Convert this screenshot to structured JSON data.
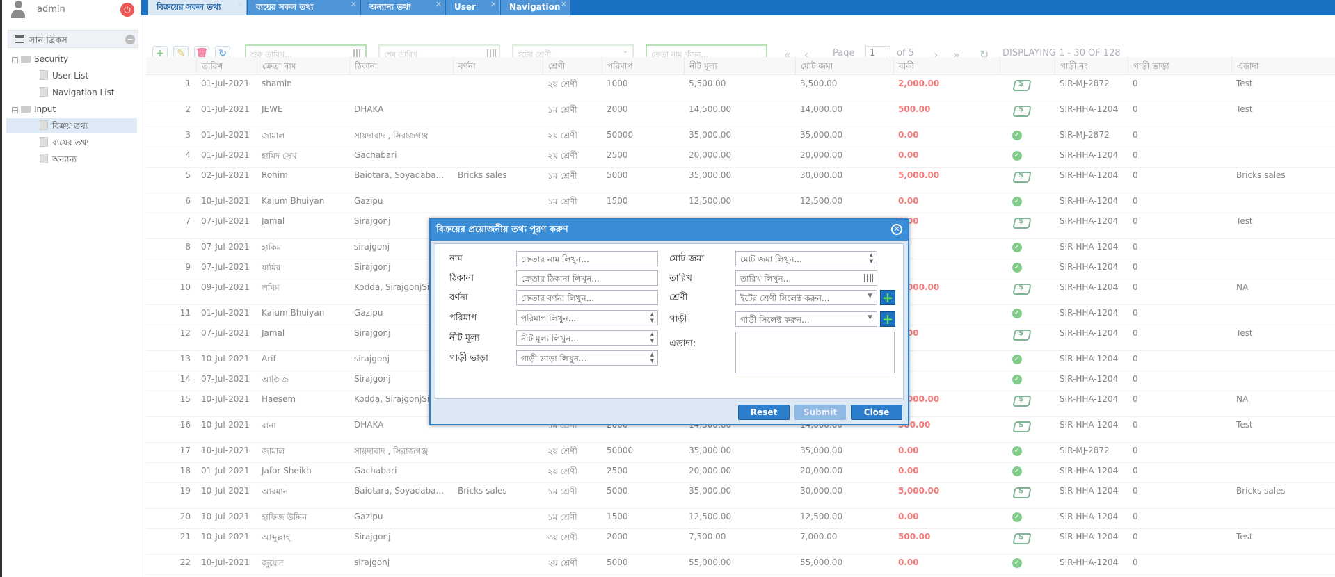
{
  "user": {
    "name": "admin"
  },
  "nav": {
    "group_title": "সান ব্রিকস",
    "tree": [
      {
        "label": "Security",
        "level": 1,
        "type": "folder"
      },
      {
        "label": "User List",
        "level": 2,
        "type": "doc"
      },
      {
        "label": "Navigation List",
        "level": 2,
        "type": "doc"
      },
      {
        "label": "Input",
        "level": 1,
        "type": "folder"
      },
      {
        "label": "বিক্রয় তথ্য",
        "level": 2,
        "type": "doc",
        "selected": true
      },
      {
        "label": "ব্যয়ের তথ্য",
        "level": 2,
        "type": "doc"
      },
      {
        "label": "অন্যান্য",
        "level": 2,
        "type": "doc"
      }
    ]
  },
  "tabs": [
    {
      "label": "বিক্রয়ের সকল তথ্য",
      "active": true
    },
    {
      "label": "ব্যয়ের সকল তথ্য",
      "active": false
    },
    {
      "label": "অন্যান্য তথ্য",
      "active": false
    },
    {
      "label": "User",
      "active": false
    },
    {
      "label": "Navigation",
      "active": false
    }
  ],
  "filters": {
    "start_date": "শুরু তারিখ...",
    "end_date": "শেষ তারিখ",
    "brick_class": "ইটের শ্রেণী",
    "buyer_search": "ক্রেতা নাম খুঁজুন..."
  },
  "pager": {
    "page_label": "Page",
    "page": "1",
    "of": "of 5",
    "display": "DISPLAYING 1 - 30 OF 128"
  },
  "columns": [
    "তারিখ",
    "ক্রেতা নাম",
    "ঠিকানা",
    "বর্ণনা",
    "শ্রেণী",
    "পরিমাপ",
    "নীট মূল্য",
    "মোট জমা",
    "বাকী",
    "",
    "গাড়ী নং",
    "গাড়ী ভাড়া",
    "এডাদা"
  ],
  "rows": [
    {
      "n": "1",
      "date": "01-Jul-2021",
      "name": "shamin",
      "addr": "",
      "desc": "",
      "cls": "২য় শ্রেণী",
      "qty": "1000",
      "net": "5,500.00",
      "paid": "3,500.00",
      "due": "2,000.00",
      "status": "pay",
      "car": "SIR-MJ-2872",
      "fare": "0",
      "note": "Test"
    },
    {
      "n": "2",
      "date": "01-Jul-2021",
      "name": "JEWE",
      "addr": "DHAKA",
      "desc": "",
      "cls": "১ম শ্রেণী",
      "qty": "2000",
      "net": "14,500.00",
      "paid": "14,000.00",
      "due": "500.00",
      "status": "pay",
      "car": "SIR-HHA-1204",
      "fare": "0",
      "note": "Test"
    },
    {
      "n": "3",
      "date": "01-Jul-2021",
      "name": "জামাল",
      "addr": "সায়দাবাদ , সিরাজগঞ্জ",
      "desc": "",
      "cls": "২য় শ্রেণী",
      "qty": "50000",
      "net": "35,000.00",
      "paid": "35,000.00",
      "due": "0.00",
      "status": "ok",
      "car": "SIR-MJ-2872",
      "fare": "0",
      "note": ""
    },
    {
      "n": "4",
      "date": "01-Jul-2021",
      "name": "হামিদ সেখ",
      "addr": "Gachabari",
      "desc": "",
      "cls": "২য় শ্রেণী",
      "qty": "2500",
      "net": "20,000.00",
      "paid": "20,000.00",
      "due": "0.00",
      "status": "ok",
      "car": "SIR-HHA-1204",
      "fare": "0",
      "note": ""
    },
    {
      "n": "5",
      "date": "02-Jul-2021",
      "name": "Rohim",
      "addr": "Baiotara, Soyadaba...",
      "desc": "Bricks sales",
      "cls": "১ম শ্রেণী",
      "qty": "5000",
      "net": "35,000.00",
      "paid": "30,000.00",
      "due": "5,000.00",
      "status": "pay",
      "car": "SIR-HHA-1204",
      "fare": "0",
      "note": "Bricks sales"
    },
    {
      "n": "6",
      "date": "10-Jul-2021",
      "name": "Kaium Bhuiyan",
      "addr": "Gazipu",
      "desc": "",
      "cls": "১ম শ্রেণী",
      "qty": "1500",
      "net": "12,500.00",
      "paid": "12,500.00",
      "due": "0.00",
      "status": "ok",
      "car": "SIR-HHA-1204",
      "fare": "0",
      "note": ""
    },
    {
      "n": "7",
      "date": "07-Jul-2021",
      "name": "Jamal",
      "addr": "Sirajgonj",
      "desc": "",
      "cls": "",
      "qty": "",
      "net": "",
      "paid": "",
      "due": "0.00",
      "status": "pay",
      "car": "SIR-HHA-1204",
      "fare": "0",
      "note": "Test"
    },
    {
      "n": "8",
      "date": "07-Jul-2021",
      "name": "হাকিম",
      "addr": "sirajgonj",
      "desc": "",
      "cls": "",
      "qty": "",
      "net": "",
      "paid": "",
      "due": "00",
      "status": "ok",
      "car": "SIR-HHA-1204",
      "fare": "0",
      "note": ""
    },
    {
      "n": "9",
      "date": "07-Jul-2021",
      "name": "য়ামির",
      "addr": "Sirajgonj",
      "desc": "",
      "cls": "",
      "qty": "",
      "net": "",
      "paid": "",
      "due": "00",
      "status": "ok",
      "car": "SIR-HHA-1204",
      "fare": "0",
      "note": ""
    },
    {
      "n": "10",
      "date": "09-Jul-2021",
      "name": "লমিম",
      "addr": "Kodda, SirajgonjSi",
      "desc": "",
      "cls": "",
      "qty": "",
      "net": "",
      "paid": "",
      "due": "5,000.00",
      "status": "pay",
      "car": "SIR-HHA-1204",
      "fare": "0",
      "note": "NA"
    },
    {
      "n": "11",
      "date": "01-Jul-2021",
      "name": "Kaium Bhuiyan",
      "addr": "Gazipu",
      "desc": "",
      "cls": "",
      "qty": "",
      "net": "",
      "paid": "",
      "due": "00",
      "status": "ok",
      "car": "SIR-HHA-1204",
      "fare": "0",
      "note": ""
    },
    {
      "n": "12",
      "date": "07-Jul-2021",
      "name": "Jamal",
      "addr": "Sirajgonj",
      "desc": "",
      "cls": "",
      "qty": "",
      "net": "",
      "paid": "",
      "due": "0.00",
      "status": "pay",
      "car": "SIR-HHA-1204",
      "fare": "0",
      "note": "Test"
    },
    {
      "n": "13",
      "date": "10-Jul-2021",
      "name": "Arif",
      "addr": "sirajgonj",
      "desc": "",
      "cls": "",
      "qty": "",
      "net": "",
      "paid": "",
      "due": "00",
      "status": "ok",
      "car": "SIR-HHA-1204",
      "fare": "0",
      "note": ""
    },
    {
      "n": "14",
      "date": "07-Jul-2021",
      "name": "আজিজ",
      "addr": "Sirajgonj",
      "desc": "",
      "cls": "",
      "qty": "",
      "net": "",
      "paid": "",
      "due": "00",
      "status": "ok",
      "car": "SIR-HHA-1204",
      "fare": "0",
      "note": ""
    },
    {
      "n": "15",
      "date": "10-Jul-2021",
      "name": "Haesem",
      "addr": "Kodda, SirajgonjSi",
      "desc": "",
      "cls": "",
      "qty": "",
      "net": "",
      "paid": "",
      "due": "5,000.00",
      "status": "pay",
      "car": "SIR-HHA-1204",
      "fare": "0",
      "note": "NA"
    },
    {
      "n": "16",
      "date": "10-Jul-2021",
      "name": "রানা",
      "addr": "DHAKA",
      "desc": "",
      "cls": "১ম শ্রেণী",
      "qty": "2000",
      "net": "14,500.00",
      "paid": "14,000.00",
      "due": "500.00",
      "status": "pay",
      "car": "SIR-HHA-1204",
      "fare": "0",
      "note": "Test"
    },
    {
      "n": "17",
      "date": "10-Jul-2021",
      "name": "জামাল",
      "addr": "সায়দাবাদ , সিরাজগঞ্জ",
      "desc": "",
      "cls": "২য় শ্রেণী",
      "qty": "50000",
      "net": "35,000.00",
      "paid": "35,000.00",
      "due": "0.00",
      "status": "ok",
      "car": "SIR-MJ-2872",
      "fare": "0",
      "note": ""
    },
    {
      "n": "18",
      "date": "01-Jul-2021",
      "name": "Jafor Sheikh",
      "addr": "Gachabari",
      "desc": "",
      "cls": "২য় শ্রেণী",
      "qty": "2500",
      "net": "20,000.00",
      "paid": "20,000.00",
      "due": "0.00",
      "status": "ok",
      "car": "SIR-HHA-1204",
      "fare": "0",
      "note": ""
    },
    {
      "n": "19",
      "date": "10-Jul-2021",
      "name": "আরমান",
      "addr": "Baiotara, Soyadaba...",
      "desc": "Bricks sales",
      "cls": "১ম শ্রেণী",
      "qty": "5000",
      "net": "35,000.00",
      "paid": "30,000.00",
      "due": "5,000.00",
      "status": "pay",
      "car": "SIR-HHA-1204",
      "fare": "0",
      "note": "Bricks sales"
    },
    {
      "n": "20",
      "date": "10-Jul-2021",
      "name": "হাফিজ উদ্দিন",
      "addr": "Gazipu",
      "desc": "",
      "cls": "১ম শ্রেণী",
      "qty": "1500",
      "net": "12,500.00",
      "paid": "12,500.00",
      "due": "0.00",
      "status": "ok",
      "car": "SIR-HHA-1204",
      "fare": "0",
      "note": ""
    },
    {
      "n": "21",
      "date": "10-Jul-2021",
      "name": "আব্দুল্লাহ",
      "addr": "Sirajgonj",
      "desc": "",
      "cls": "৩য় শ্রেণী",
      "qty": "2000",
      "net": "7,500.00",
      "paid": "7,000.00",
      "due": "500.00",
      "status": "pay",
      "car": "SIR-HHA-1204",
      "fare": "0",
      "note": "Test"
    },
    {
      "n": "22",
      "date": "10-Jul-2021",
      "name": "জুয়েল",
      "addr": "sirajgonj",
      "desc": "",
      "cls": "২য় শ্রেণী",
      "qty": "5000",
      "net": "55,000.00",
      "paid": "55,000.00",
      "due": "0.00",
      "status": "ok",
      "car": "SIR-HHA-1204",
      "fare": "0",
      "note": ""
    }
  ],
  "dialog": {
    "title": "বিক্রয়ের প্রয়োজনীয় তথ্য পূরণ করুণ",
    "fields": {
      "name_label": "নাম",
      "name_ph": "ক্রেতার নাম লিখুন...",
      "addr_label": "ঠিকানা",
      "addr_ph": "ক্রেতার ঠিকানা লিখুন...",
      "desc_label": "বর্ণনা",
      "desc_ph": "ক্রেতার বর্ণনা লিখুন...",
      "qty_label": "পরিমাপ",
      "qty_ph": "পরিমাপ লিখুন...",
      "net_label": "নীট মূল্য",
      "net_ph": "নীট মূল্য লিখুন...",
      "fare_label": "গাড়ী ভাড়া",
      "fare_ph": "গাড়ী ভাড়া লিখুন...",
      "paid_label": "মোট জমা",
      "paid_ph": "মোট জমা লিখুন...",
      "date_label": "তারিখ",
      "date_ph": "তারিখ লিখুন...",
      "cls_label": "শ্রেণী",
      "cls_ph": "ইটের শ্রেণী সিলেক্ট করুন...",
      "car_label": "গাড়ী",
      "car_ph": "গাড়ী সিলেক্ট করুন...",
      "note_label": "এডাদা:"
    },
    "buttons": {
      "reset": "Reset",
      "submit": "Submit",
      "close": "Close"
    }
  }
}
